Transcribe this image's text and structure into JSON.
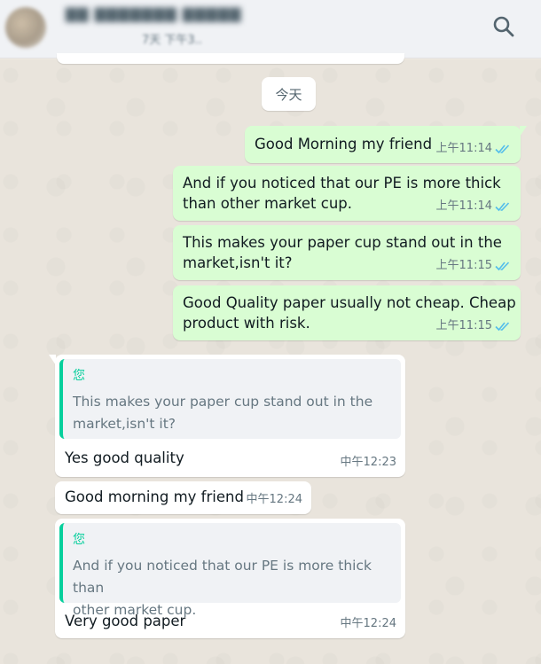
{
  "header": {
    "contact_name": "▇▇ ▇▇▇▇▇▇▇ ▇▇▇▇▇",
    "status": "7天 下午3..",
    "search_icon": "search-icon"
  },
  "date_separator": "今天",
  "messages": [
    {
      "direction": "out",
      "text": "Good Morning my friend",
      "time": "上午11:14",
      "status": "read"
    },
    {
      "direction": "out",
      "text_lines": [
        "And if you noticed that our PE is more thick",
        "than other market cup."
      ],
      "time": "上午11:14",
      "status": "read"
    },
    {
      "direction": "out",
      "text_lines": [
        "This makes your paper cup stand out in the",
        "market,isn't it?"
      ],
      "time": "上午11:15",
      "status": "read"
    },
    {
      "direction": "out",
      "text_lines": [
        "Good Quality paper usually not cheap. Cheap",
        "product with risk."
      ],
      "time": "上午11:15",
      "status": "read"
    },
    {
      "direction": "in",
      "quote": {
        "author": "您",
        "lines": [
          "This makes your paper cup stand out in the",
          "market,isn't it?"
        ]
      },
      "text": "Yes good quality",
      "time": "中午12:23"
    },
    {
      "direction": "in",
      "text": "Good morning my friend",
      "time": "中午12:24"
    },
    {
      "direction": "in",
      "quote": {
        "author": "您",
        "lines": [
          "And if you noticed that our PE is more thick than",
          "other market cup."
        ]
      },
      "text": "Very good paper",
      "time": "中午12:24"
    }
  ],
  "colors": {
    "outgoing_bubble": "#d9fdd3",
    "incoming_bubble": "#ffffff",
    "read_ticks": "#53bdeb",
    "quote_accent": "#06cf9c"
  }
}
